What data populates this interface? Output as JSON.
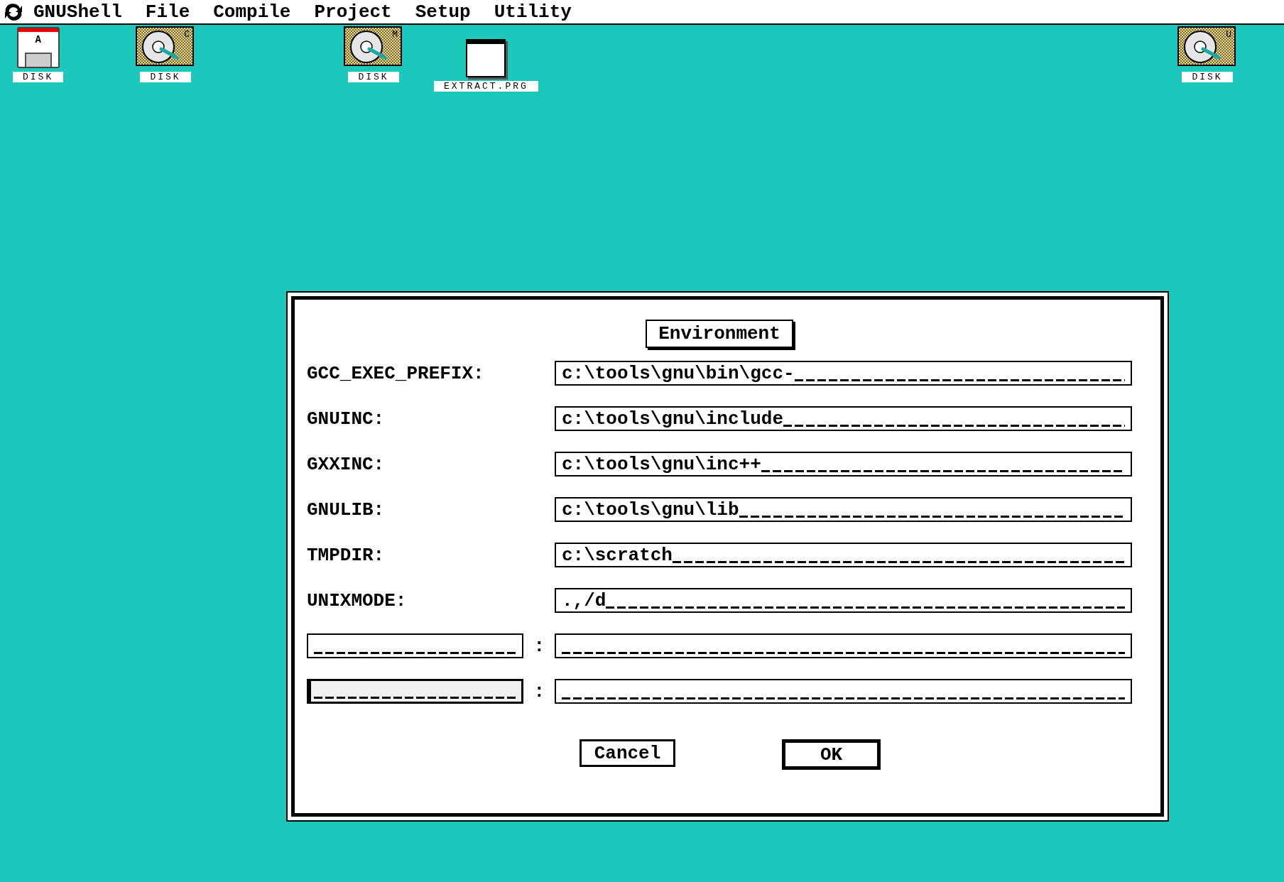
{
  "menu_bar": {
    "items": [
      {
        "label": "GNUShell"
      },
      {
        "label": "File"
      },
      {
        "label": "Compile"
      },
      {
        "label": "Project"
      },
      {
        "label": "Setup"
      },
      {
        "label": "Utility"
      }
    ]
  },
  "desktop_icons": [
    {
      "kind": "floppy",
      "drive_letter": "A",
      "label": "DISK"
    },
    {
      "kind": "harddisk",
      "drive_letter": "C",
      "label": "DISK"
    },
    {
      "kind": "harddisk",
      "drive_letter": "M",
      "label": "DISK"
    },
    {
      "kind": "program",
      "label": "EXTRACT.PRG"
    },
    {
      "kind": "harddisk",
      "drive_letter": "U",
      "label": "DISK"
    }
  ],
  "dialog": {
    "title": "Environment",
    "rows": [
      {
        "kind": "fixed",
        "label": "GCC_EXEC_PREFIX:",
        "value": "c:\\tools\\gnu\\bin\\gcc-"
      },
      {
        "kind": "fixed",
        "label": "GNUINC:",
        "value": "c:\\tools\\gnu\\include"
      },
      {
        "kind": "fixed",
        "label": "GXXINC:",
        "value": "c:\\tools\\gnu\\inc++"
      },
      {
        "kind": "fixed",
        "label": "GNULIB:",
        "value": "c:\\tools\\gnu\\lib"
      },
      {
        "kind": "fixed",
        "label": "TMPDIR:",
        "value": "c:\\scratch"
      },
      {
        "kind": "fixed",
        "label": "UNIXMODE:",
        "value": ".,/d"
      },
      {
        "kind": "custom",
        "separator": ":",
        "focused": false
      },
      {
        "kind": "custom",
        "separator": ":",
        "focused": true
      }
    ],
    "buttons": [
      {
        "label": "Cancel",
        "default": false
      },
      {
        "label": "OK",
        "default": true
      }
    ]
  }
}
